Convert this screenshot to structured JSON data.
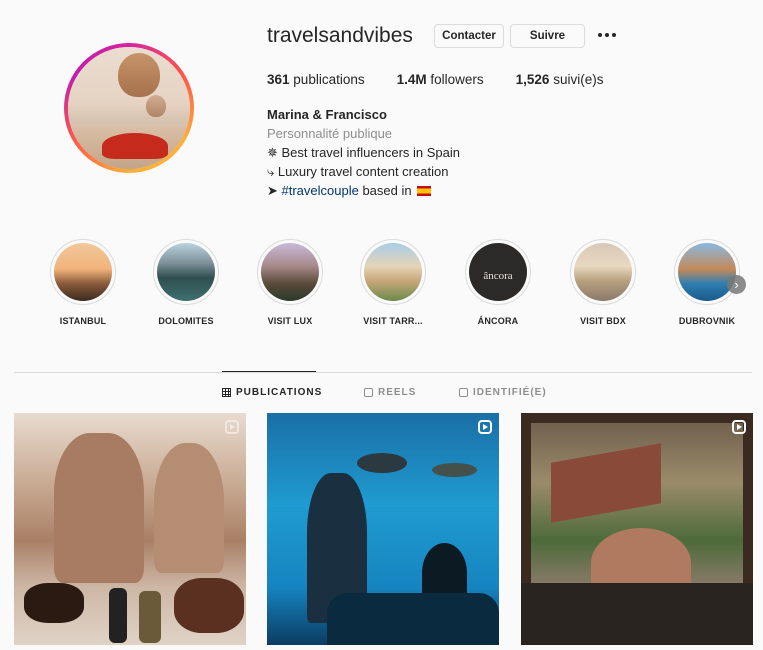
{
  "profile": {
    "username": "travelsandvibes",
    "contact_label": "Contacter",
    "follow_label": "Suivre",
    "stats": {
      "posts_count": "361",
      "posts_label": "publications",
      "followers_count": "1.4M",
      "followers_label": "followers",
      "following_count": "1,526",
      "following_label": "suivi(e)s"
    },
    "full_name": "Marina & Francisco",
    "category": "Personnalité publique",
    "bio": {
      "line1": "✵ Best travel influencers in Spain",
      "line2": "⤷ Luxury travel content creation",
      "line3_prefix": "➤ ",
      "line3_hashtag": "#travelcouple",
      "line3_suffix": " based in "
    }
  },
  "highlights": [
    {
      "label": "ISTANBUL"
    },
    {
      "label": "DOLOMITES"
    },
    {
      "label": "VISIT LUX"
    },
    {
      "label": "VISIT TARR..."
    },
    {
      "label": "ÁNCORA",
      "logo_text": "âncora"
    },
    {
      "label": "VISIT BDX"
    },
    {
      "label": "DUBROVNIK"
    }
  ],
  "tabs": {
    "publications": "PUBLICATIONS",
    "reels": "REELS",
    "tagged": "IDENTIFIÉ(E)"
  },
  "icons": {
    "more": "more-options-icon",
    "next": "chevron-right-icon",
    "grid": "grid-icon",
    "reels": "reels-icon",
    "tagged": "tagged-icon",
    "reel_badge": "reel-icon"
  },
  "colors": {
    "background": "#fafafa",
    "text": "#262626",
    "muted": "#8e8e8e",
    "hashtag": "#00376b",
    "border": "#dbdbdb"
  }
}
